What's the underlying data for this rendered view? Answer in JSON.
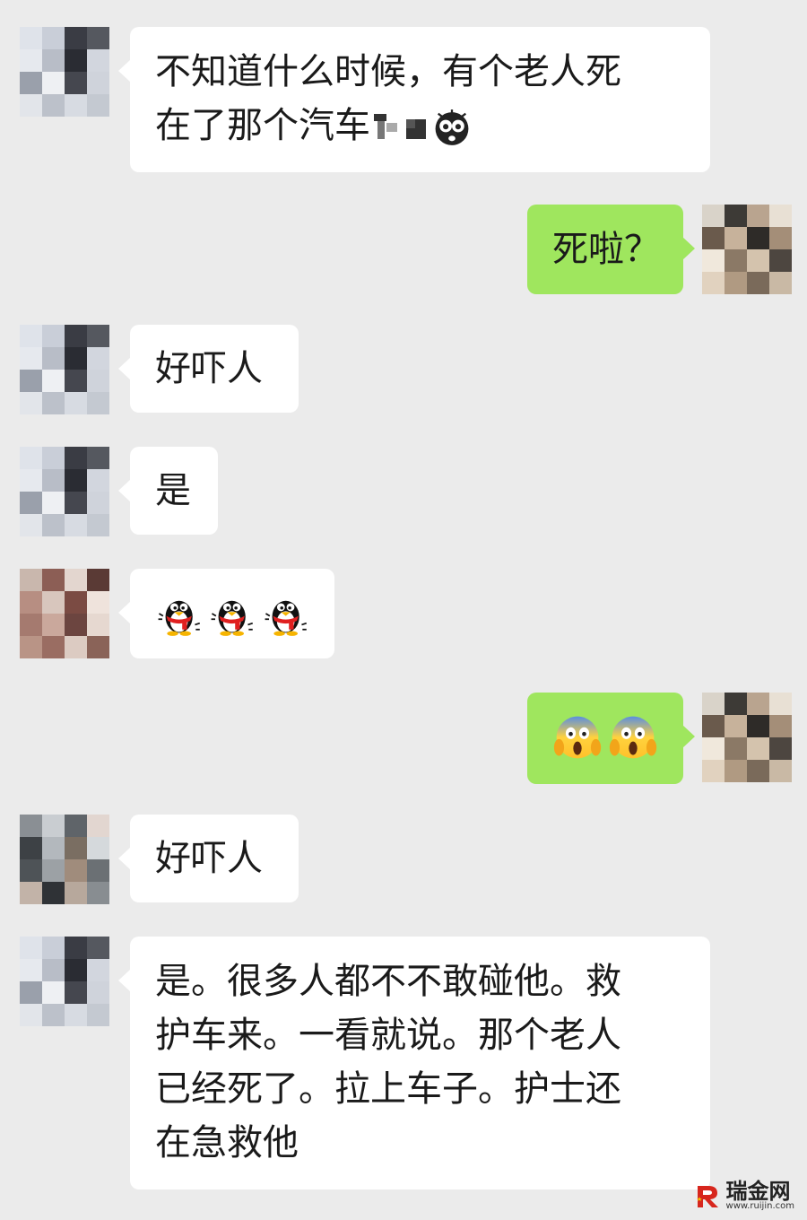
{
  "messages": [
    {
      "side": "in",
      "lines": [
        "不知道什么时候，有个老人死",
        "在了那个汽车"
      ],
      "trailing": [
        "censored-block",
        "censored-block",
        "shocked-face-emoji"
      ]
    },
    {
      "side": "out",
      "lines": [
        "死啦？"
      ]
    },
    {
      "side": "in",
      "lines": [
        "好吓人"
      ]
    },
    {
      "side": "in",
      "lines": [
        "是"
      ]
    },
    {
      "side": "in",
      "emoji": [
        "penguin-emoji",
        "penguin-emoji",
        "penguin-emoji"
      ]
    },
    {
      "side": "out",
      "emoji": [
        "screaming-face-emoji",
        "screaming-face-emoji"
      ]
    },
    {
      "side": "in",
      "lines": [
        "好吓人"
      ]
    },
    {
      "side": "in",
      "lines": [
        "是。很多人都不不敢碰他。救",
        "护车来。一看就说。那个老人",
        "已经死了。拉上车子。护士还",
        "在急救他"
      ]
    }
  ],
  "watermark": {
    "name": "瑞金网",
    "url": "www.ruijin.com",
    "brand_color": "#d7261d"
  },
  "colors": {
    "background": "#ebebeb",
    "incoming_bubble": "#ffffff",
    "outgoing_bubble": "#9fe65e"
  }
}
